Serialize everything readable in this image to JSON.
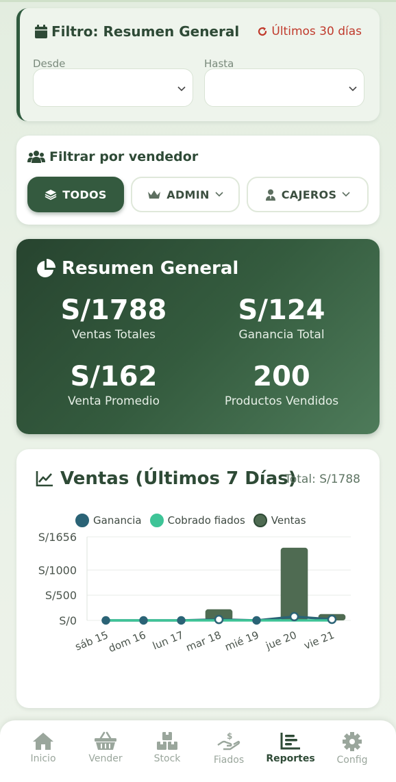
{
  "filter": {
    "title": "Filtro: Resumen General",
    "reset_label": "Últimos 30 días",
    "from_label": "Desde",
    "to_label": "Hasta",
    "from_value": "",
    "to_value": ""
  },
  "vendor": {
    "title": "Filtrar por vendedor",
    "options": [
      "TODOS",
      "ADMIN",
      "CAJEROS"
    ],
    "selected": "TODOS"
  },
  "summary": {
    "title": "Resumen General",
    "stats": [
      {
        "value": "S/1788",
        "label": "Ventas Totales"
      },
      {
        "value": "S/124",
        "label": "Ganancia Total"
      },
      {
        "value": "S/162",
        "label": "Venta Promedio"
      },
      {
        "value": "200",
        "label": "Productos Vendidos"
      }
    ]
  },
  "chart": {
    "title": "Ventas (Últimos 7 Días)",
    "total_label": "Total: S/1788"
  },
  "chart_data": {
    "type": "bar",
    "categories": [
      "sáb 15",
      "dom 16",
      "lun 17",
      "mar 18",
      "mié 19",
      "jue 20",
      "vie 21"
    ],
    "series": [
      {
        "name": "Ganancia",
        "type": "line",
        "color": "#2b6376",
        "values": [
          0,
          0,
          0,
          18,
          0,
          75,
          20
        ]
      },
      {
        "name": "Cobrado fiados",
        "type": "line",
        "color": "#3ec497",
        "values": [
          0,
          0,
          0,
          0,
          0,
          0,
          0
        ]
      },
      {
        "name": "Ventas",
        "type": "bar",
        "color": "#4f6b52",
        "values": [
          0,
          0,
          0,
          220,
          0,
          1440,
          125
        ]
      }
    ],
    "yticks": [
      "S/0",
      "S/500",
      "S/1000",
      "S/1656"
    ],
    "ytick_values": [
      0,
      500,
      1000,
      1656
    ],
    "ylim": [
      0,
      1656
    ],
    "grid": true,
    "legend": "top"
  },
  "nav": {
    "items": [
      "Inicio",
      "Vender",
      "Stock",
      "Fiados",
      "Reportes",
      "Config"
    ],
    "active": "Reportes"
  },
  "colors": {
    "primary": "#345a3f",
    "accent_red": "#c0392b",
    "background": "#e9f1e6"
  }
}
